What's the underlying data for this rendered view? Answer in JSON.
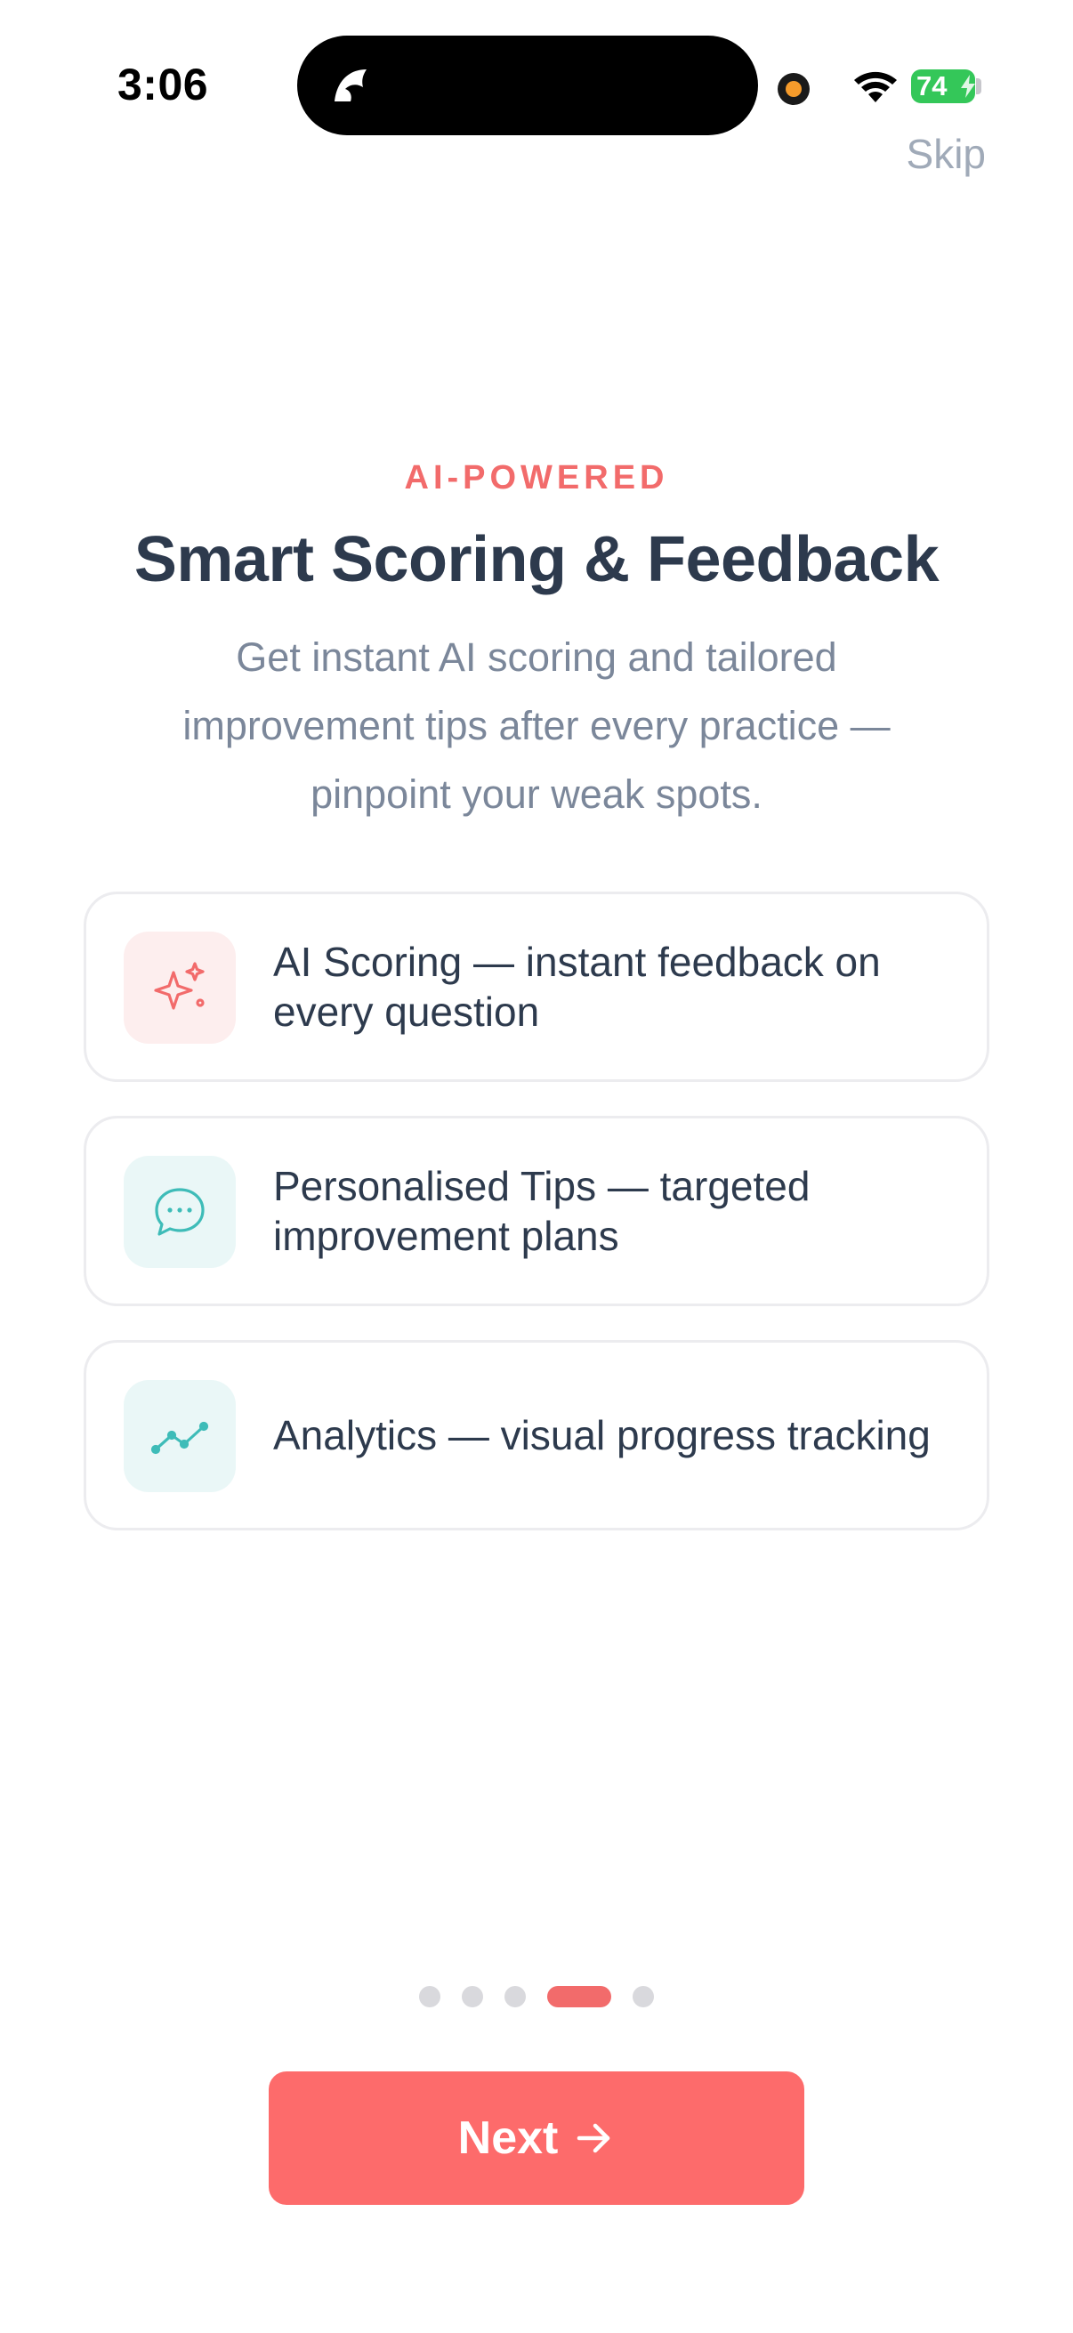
{
  "status_bar": {
    "time": "3:06",
    "battery": "74"
  },
  "header": {
    "skip_label": "Skip",
    "eyebrow": "AI-POWERED",
    "title": "Smart Scoring & Feedback",
    "subtitle": "Get instant AI scoring and tailored improvement tips after every practice — pinpoint your weak spots."
  },
  "features": [
    {
      "icon": "sparkles-icon",
      "text": "AI Scoring — instant feedback on every question",
      "icon_bg": "#fdeeee",
      "icon_color": "#f26b6b"
    },
    {
      "icon": "chat-bubble-icon",
      "text": "Personalised Tips — targeted improvement plans",
      "icon_bg": "#eaf7f7",
      "icon_color": "#3ebcb8"
    },
    {
      "icon": "trend-line-icon",
      "text": "Analytics — visual progress tracking",
      "icon_bg": "#eaf7f7",
      "icon_color": "#3ebcb8"
    }
  ],
  "pager": {
    "total": 5,
    "current": 4
  },
  "next_button": {
    "label": "Next"
  },
  "colors": {
    "accent": "#fd6b6b",
    "title": "#2d3a4d",
    "muted": "#7b879a"
  }
}
